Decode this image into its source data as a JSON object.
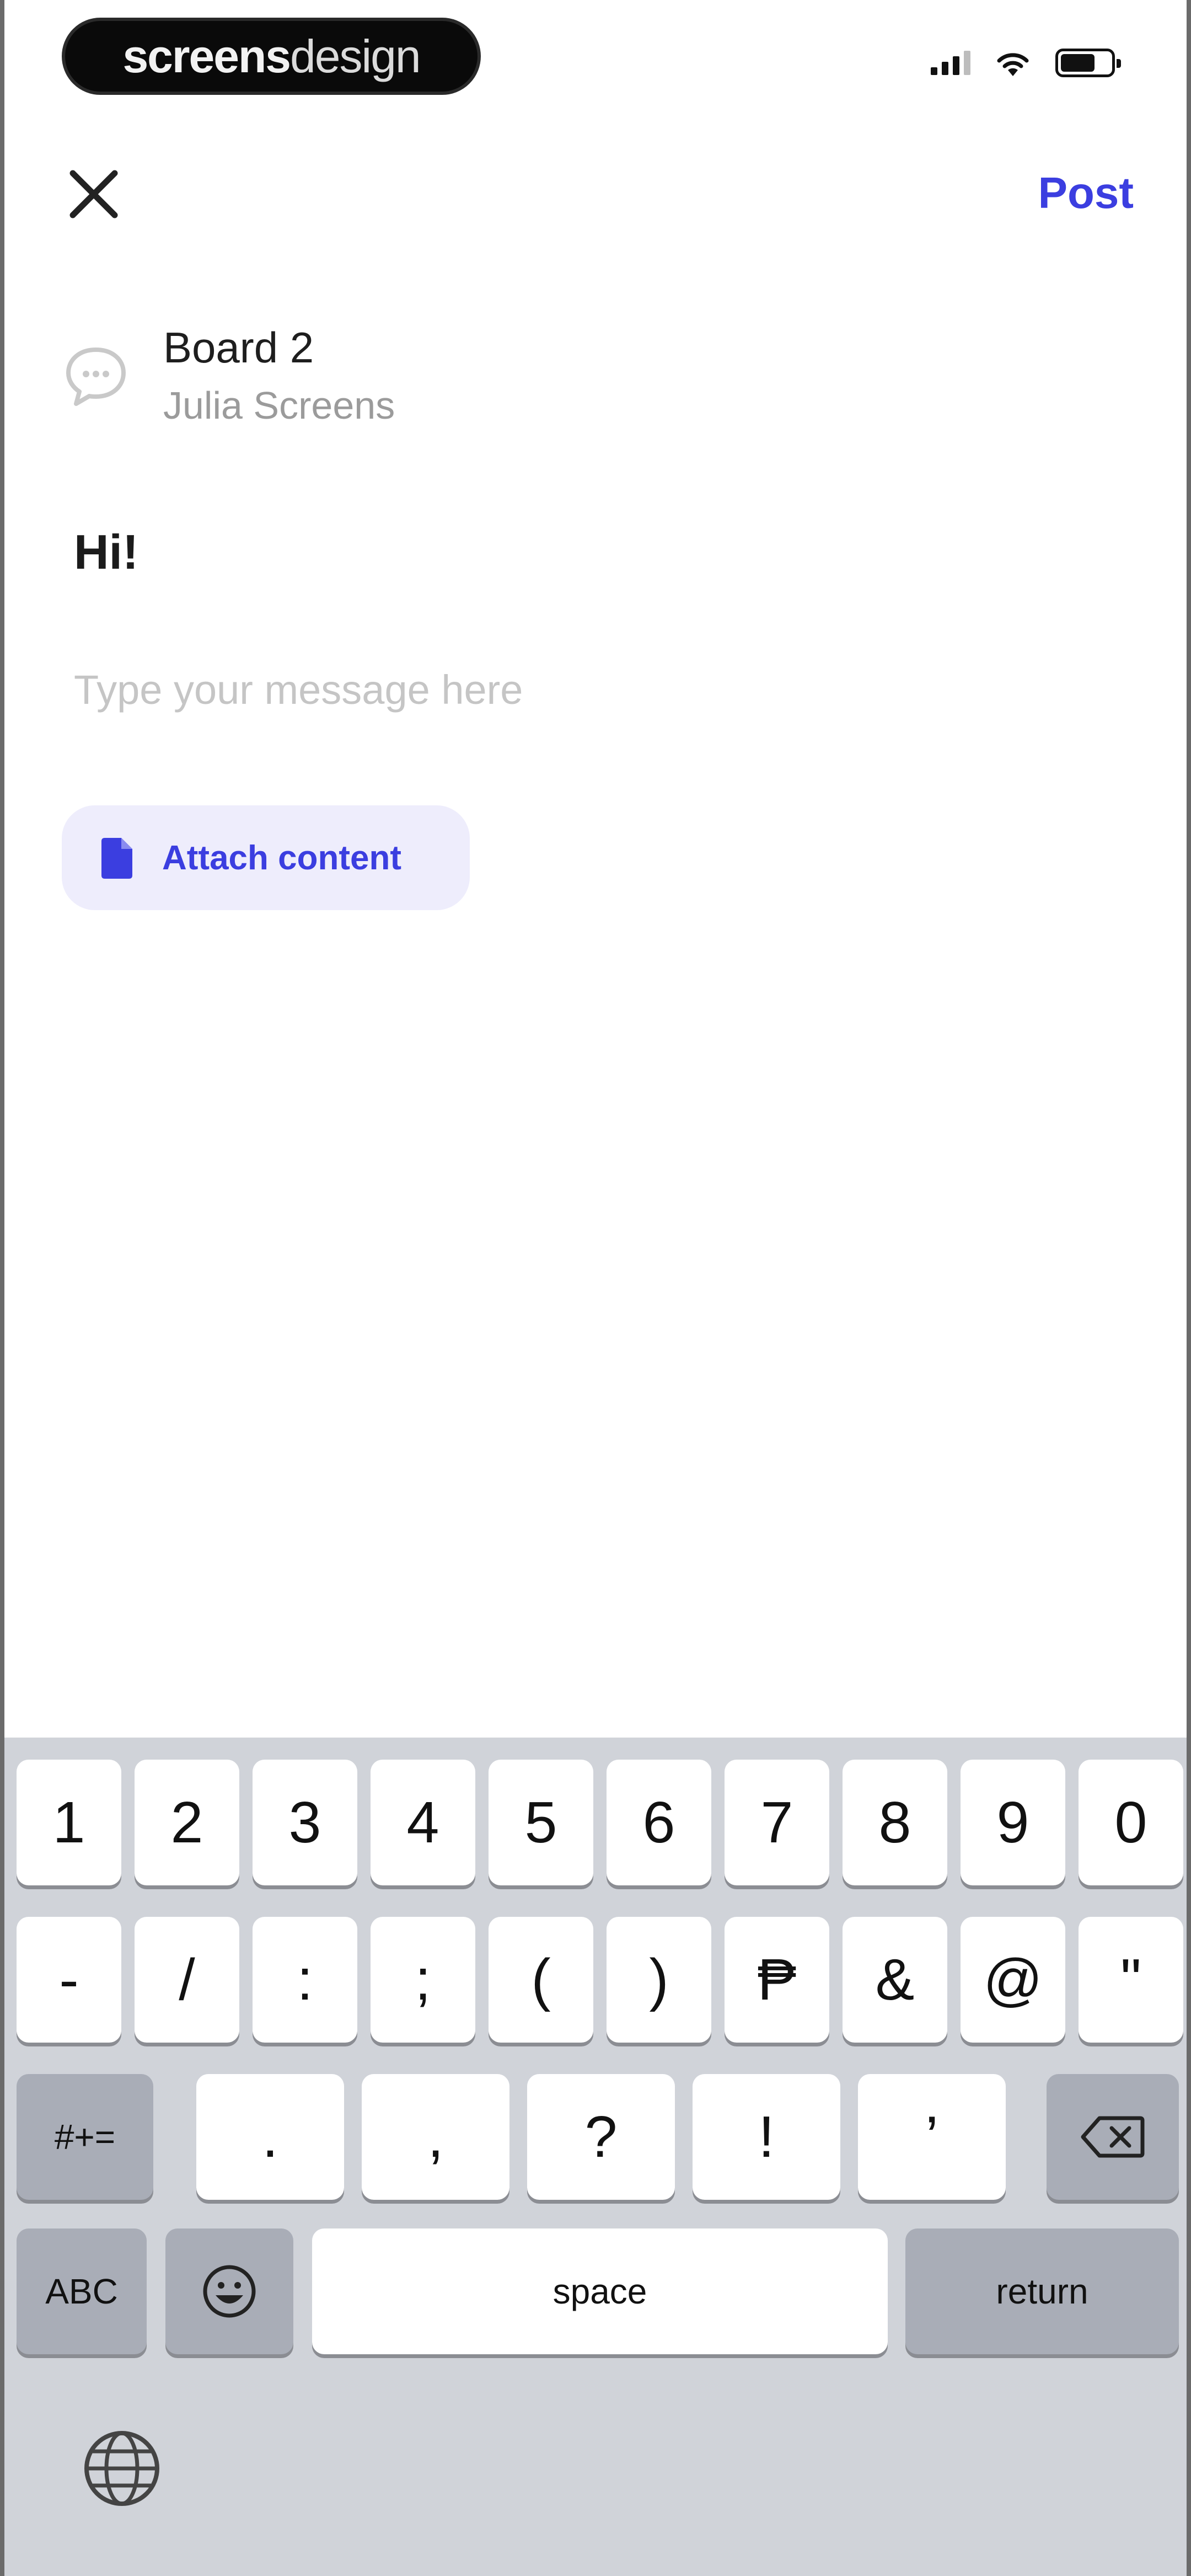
{
  "status_bar": {
    "brand_bold": "screens",
    "brand_light": "design"
  },
  "header": {
    "post_label": "Post"
  },
  "board": {
    "title": "Board 2",
    "subtitle": "Julia Screens"
  },
  "compose": {
    "title": "Hi!",
    "message_placeholder": "Type your message here",
    "attach_label": "Attach content"
  },
  "keyboard": {
    "row1": [
      "1",
      "2",
      "3",
      "4",
      "5",
      "6",
      "7",
      "8",
      "9",
      "0"
    ],
    "row2": [
      "-",
      "/",
      ":",
      ";",
      "(",
      ")",
      "₱",
      "&",
      "@",
      "\""
    ],
    "row3": {
      "symbols": "#+=",
      "keys": [
        ".",
        ",",
        "?",
        "!",
        "’"
      ]
    },
    "row4": {
      "abc": "ABC",
      "space": "space",
      "return": "return"
    }
  },
  "colors": {
    "accent": "#3b3ee0",
    "attach_bg": "#eeedfc",
    "keyboard_bg": "#d0d3d9"
  },
  "icons": [
    "close-icon",
    "chat-bubble-icon",
    "attachment-icon",
    "signal-icon",
    "wifi-icon",
    "battery-icon",
    "delete-icon",
    "emoji-icon",
    "globe-icon"
  ]
}
